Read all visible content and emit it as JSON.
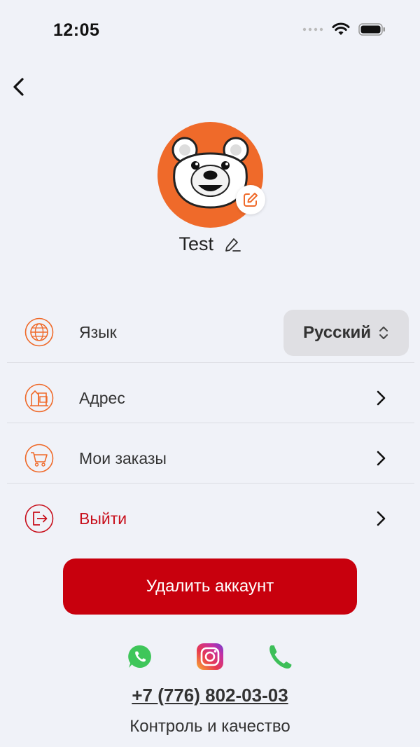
{
  "status_bar": {
    "time": "12:05"
  },
  "profile": {
    "name": "Test"
  },
  "menu": [
    {
      "id": "language",
      "label": "Язык",
      "icon": "globe-icon",
      "value": "Русский"
    },
    {
      "id": "address",
      "label": "Адрес",
      "icon": "address-building-icon"
    },
    {
      "id": "orders",
      "label": "Мои заказы",
      "icon": "cart-icon"
    },
    {
      "id": "logout",
      "label": "Выйти",
      "icon": "logout-icon"
    }
  ],
  "delete_account_label": "Удалить аккаунт",
  "contacts": {
    "social": [
      "whatsapp-icon",
      "instagram-icon",
      "phone-icon"
    ],
    "phone": "+7 (776) 802-03-03",
    "caption": "Контроль и качество"
  },
  "colors": {
    "accent": "#ef6a2a",
    "danger": "#c8000d",
    "logout_text": "#c8101c",
    "background": "#f0f2f8"
  }
}
